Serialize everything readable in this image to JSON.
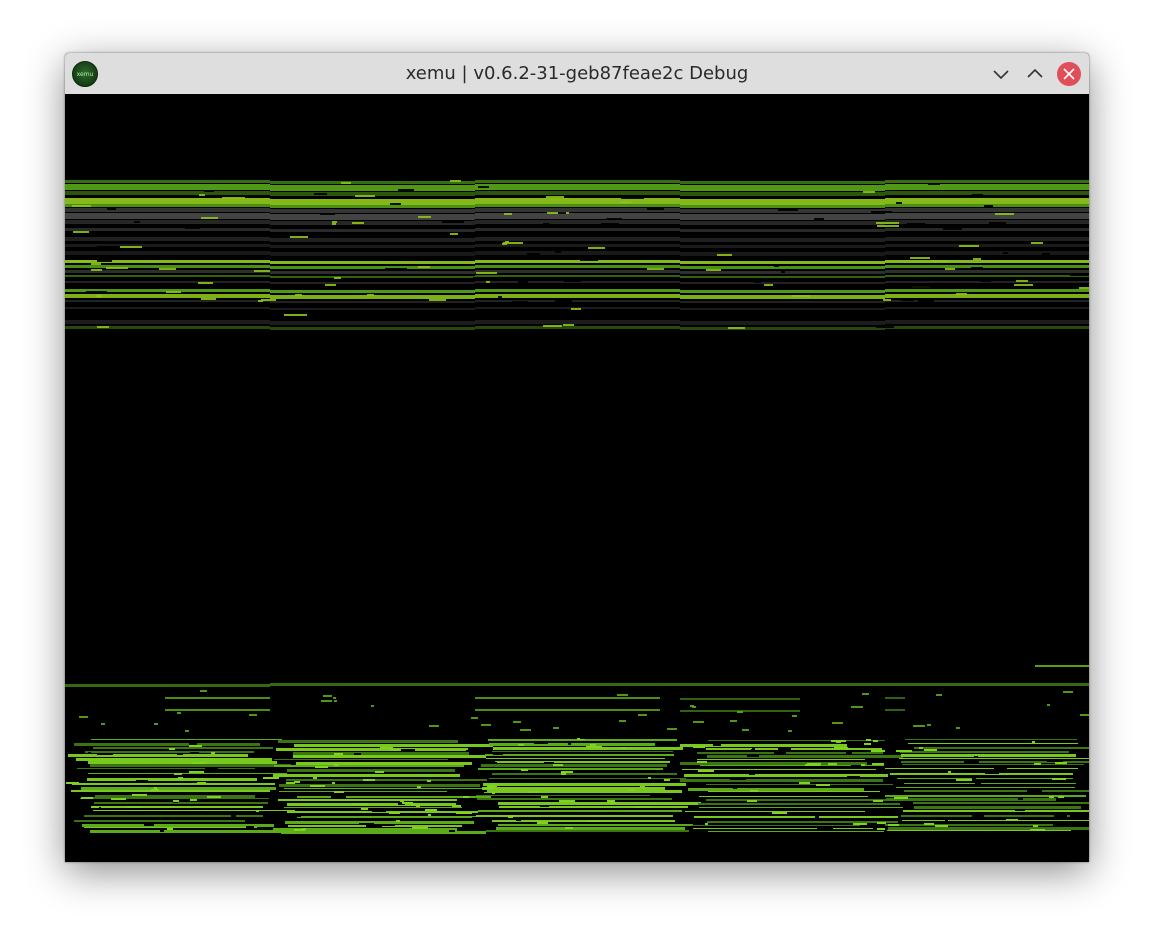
{
  "window": {
    "title": "xemu | v0.6.2-31-geb87feae2c Debug",
    "app_icon_label": "xemu",
    "buttons": {
      "minimize_icon": "chevron-down-icon",
      "maximize_icon": "chevron-up-icon",
      "close_icon": "close-icon"
    }
  },
  "colors": {
    "titlebar": "#dedede",
    "close_button": "#e04e5a",
    "glitch_green_bright": "#7ed321",
    "glitch_green_mid": "#5fb31a",
    "glitch_green_dark": "#3d7a14",
    "glitch_yellowgreen": "#8cc21a",
    "glitch_gray": "#3a3a3a"
  }
}
